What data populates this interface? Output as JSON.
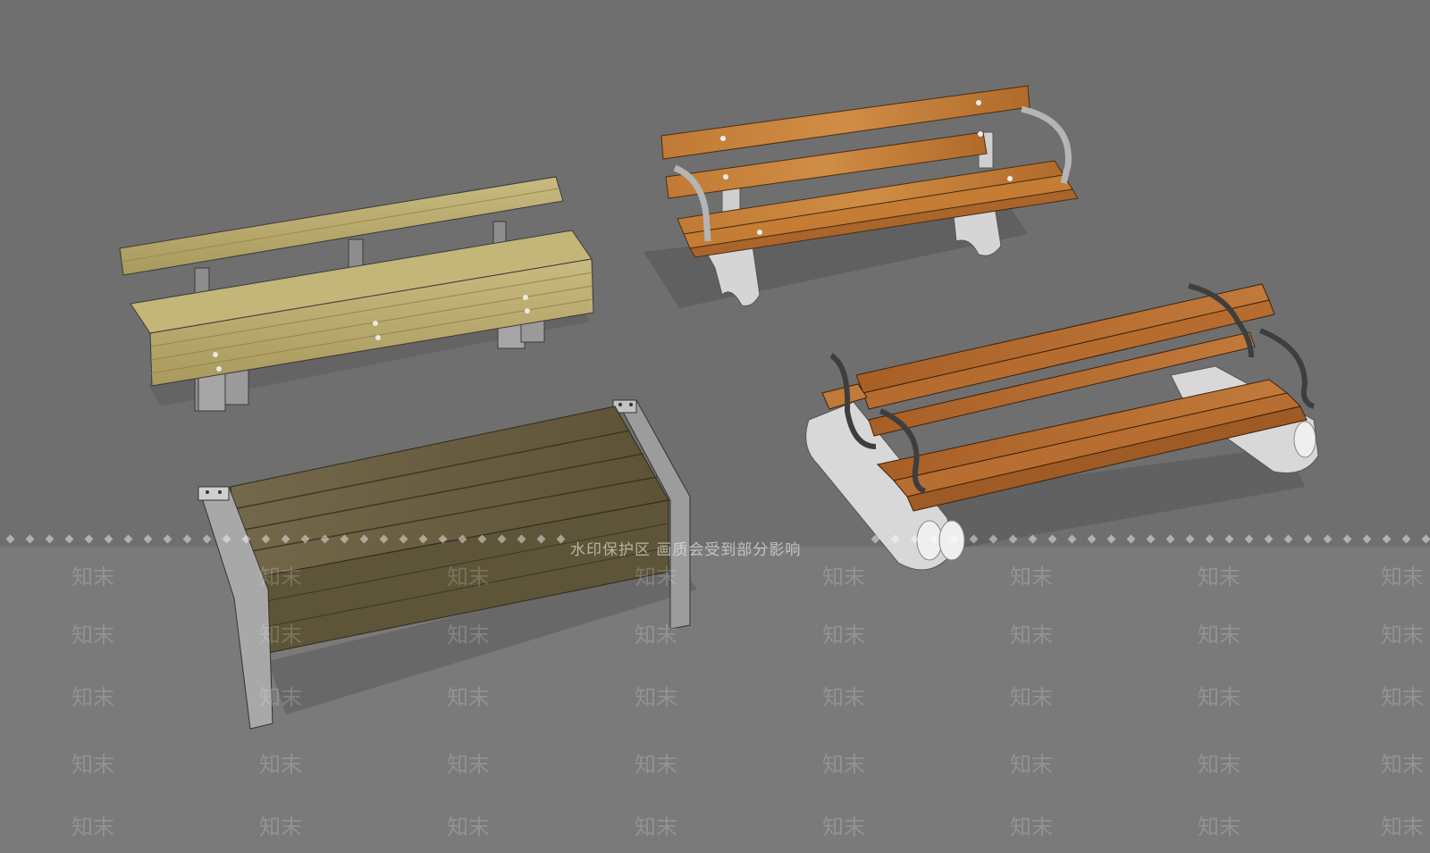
{
  "scene": {
    "background_color": "#6f6f6f",
    "lower_band_color": "#7a7a7a",
    "models": [
      {
        "name": "bench-1",
        "kind": "light wood bench with metal legs",
        "wood_color": "#b8a86b"
      },
      {
        "name": "bench-2",
        "kind": "orange slat bench with stone legs and curved armrests",
        "wood_color": "#b8732e"
      },
      {
        "name": "bench-3",
        "kind": "dark wood box bench with steel frame",
        "wood_color": "#6b5e3e"
      },
      {
        "name": "bench-4",
        "kind": "double slat bench with carved stone ends",
        "wood_color": "#a6622a"
      }
    ]
  },
  "watermark": {
    "caption": "水印保护区  画质会受到部分影响",
    "tile_text": "知末"
  }
}
